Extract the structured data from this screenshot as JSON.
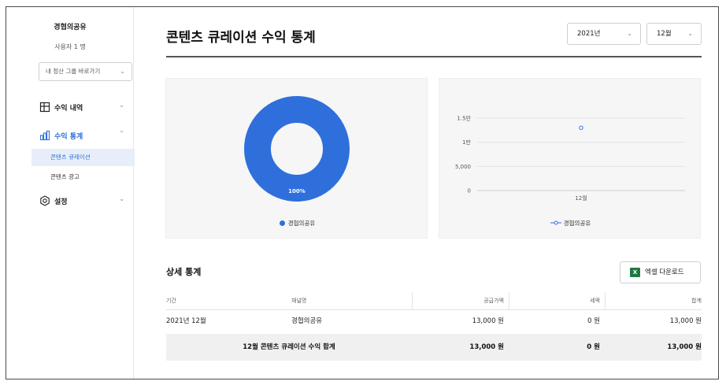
{
  "sidebar": {
    "org_name": "경협의공유",
    "user_count": "사용자 1 명",
    "group_select": "내 정산 그룹 바로가기",
    "menu": [
      {
        "label": "수익 내역"
      },
      {
        "label": "수익 통계",
        "submenu": [
          "콘텐츠 큐레이션",
          "콘텐츠 광고"
        ]
      },
      {
        "label": "설정"
      }
    ]
  },
  "main": {
    "title": "콘텐츠 큐레이션 수익 통계",
    "year_select": "2021년",
    "month_select": "12월"
  },
  "donut": {
    "label": "100%",
    "legend": "경협의공유",
    "color": "#2f6fdc"
  },
  "chart_data": {
    "type": "line",
    "categories": [
      "12월"
    ],
    "series": [
      {
        "name": "경협의공유",
        "values": [
          13000
        ]
      }
    ],
    "y_ticks": [
      "0",
      "5,000",
      "1만",
      "1.5만"
    ],
    "ylim": [
      0,
      15000
    ],
    "grid": true,
    "legend_position": "bottom"
  },
  "details": {
    "title": "상세 통계",
    "excel_icon": "X",
    "excel_label": "엑셀 다운로드",
    "columns": [
      "기간",
      "채널명",
      "공급가액",
      "세액",
      "합계"
    ],
    "rows": [
      [
        "2021년 12월",
        "경협의공유",
        "13,000 원",
        "0 원",
        "13,000 원"
      ]
    ],
    "total": {
      "label": "12월 콘텐츠 큐레이션 수익 합계",
      "supply": "13,000 원",
      "tax": "0 원",
      "sum": "13,000 원"
    }
  }
}
